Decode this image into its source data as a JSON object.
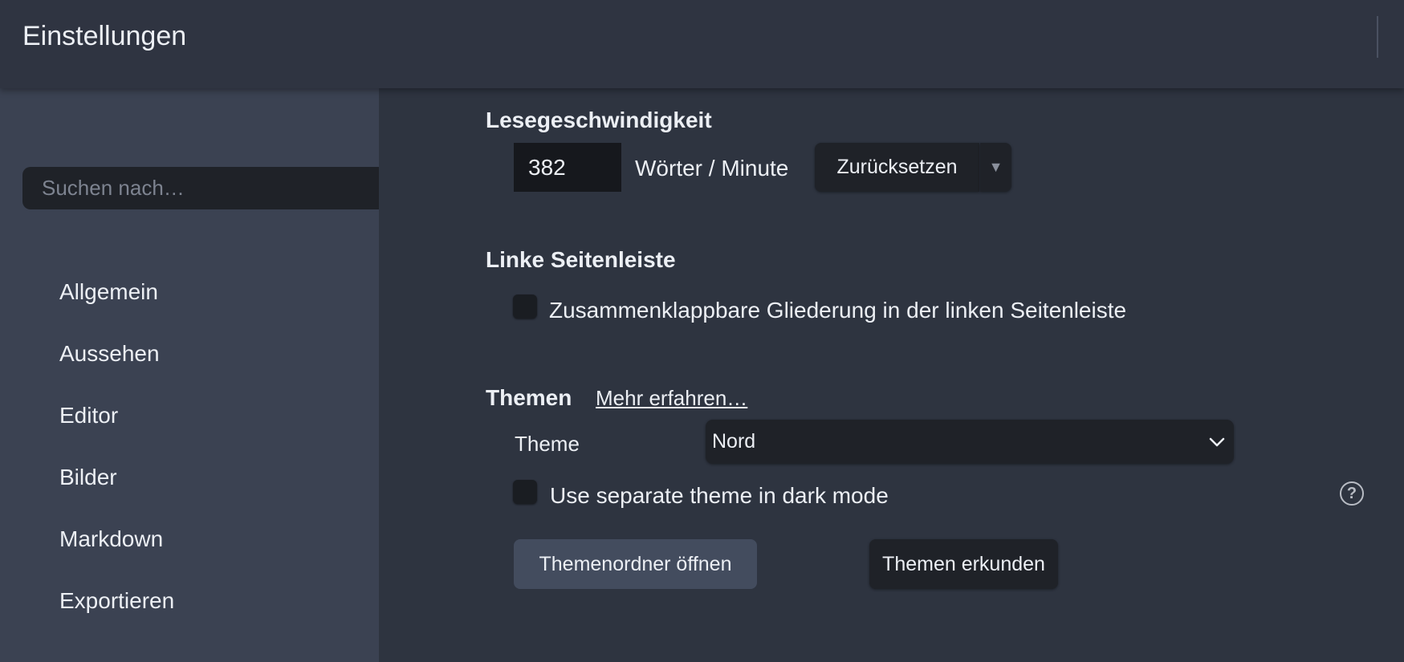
{
  "window": {
    "title": "Einstellungen"
  },
  "sidebar": {
    "search_placeholder": "Suchen nach…",
    "items": [
      {
        "label": "Allgemein"
      },
      {
        "label": "Aussehen"
      },
      {
        "label": "Editor"
      },
      {
        "label": "Bilder"
      },
      {
        "label": "Markdown"
      },
      {
        "label": "Exportieren"
      }
    ]
  },
  "reading_speed": {
    "title": "Lesegeschwindigkeit",
    "value": "382",
    "unit": "Wörter / Minute",
    "reset_label": "Zurücksetzen",
    "dropdown_glyph": "▼"
  },
  "left_sidebar": {
    "title": "Linke Seitenleiste",
    "collapsible_outline_label": "Zusammenklappbare Gliederung in der linken Seitenleiste",
    "collapsible_outline_checked": false
  },
  "themes": {
    "title": "Themen",
    "learn_more": "Mehr erfahren…",
    "theme_label": "Theme",
    "theme_value": "Nord",
    "separate_dark_label": "Use separate theme in dark mode",
    "separate_dark_checked": false,
    "help_glyph": "?",
    "open_folder_label": "Themenordner öffnen",
    "explore_label": "Themen erkunden"
  },
  "colors": {
    "background": "#2e3440",
    "sidebar": "#3b4252",
    "control_dark": "#1f2228",
    "button_gray": "#434c5e",
    "text": "#eceff4"
  }
}
